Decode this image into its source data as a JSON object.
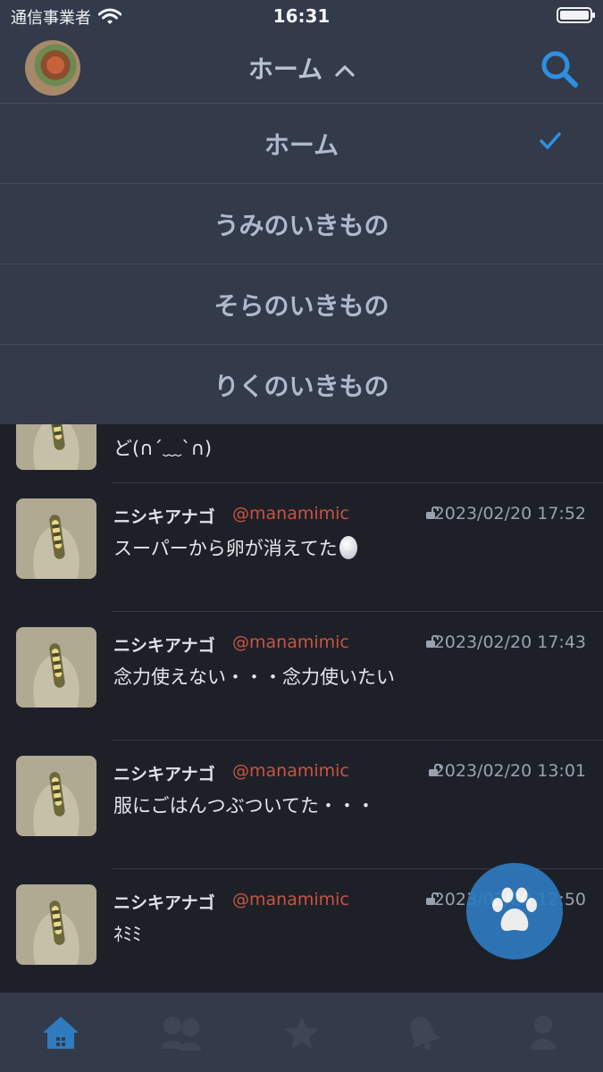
{
  "status_bar": {
    "carrier": "通信事業者",
    "time": "16:31"
  },
  "nav": {
    "title": "ホーム",
    "title_chevron": "chevron-up-icon",
    "search_icon": "search-icon"
  },
  "menu": {
    "items": [
      {
        "label": "ホーム",
        "selected": true
      },
      {
        "label": "うみのいきもの",
        "selected": false
      },
      {
        "label": "そらのいきもの",
        "selected": false
      },
      {
        "label": "りくのいきもの",
        "selected": false
      }
    ]
  },
  "timeline": {
    "partial_text": "ど(∩´﹏`∩)",
    "tweets": [
      {
        "name": "ニシキアナゴ",
        "handle": "@manamimic",
        "date": "2023/02/20 17:52",
        "text": "スーパーから卵が消えてた"
      },
      {
        "name": "ニシキアナゴ",
        "handle": "@manamimic",
        "date": "2023/02/20 17:43",
        "text": "念力使えない・・・念力使いたい"
      },
      {
        "name": "ニシキアナゴ",
        "handle": "@manamimic",
        "date": "2023/02/20 13:01",
        "text": "服にごはんつぶついてた・・・"
      },
      {
        "name": "ニシキアナゴ",
        "handle": "@manamimic",
        "date": "2023/02/20 12:50",
        "text": "ﾈﾐﾐ"
      }
    ]
  },
  "fab": {
    "icon": "paw-icon"
  },
  "tab_bar": {
    "tabs": [
      {
        "icon": "home-icon",
        "active": true
      },
      {
        "icon": "users-icon",
        "active": false
      },
      {
        "icon": "star-icon",
        "active": false
      },
      {
        "icon": "bell-icon",
        "active": false
      },
      {
        "icon": "person-icon",
        "active": false
      }
    ]
  },
  "colors": {
    "accent": "#2f7bbf",
    "handle": "#c8553f",
    "bar_bg": "#333a4a",
    "page_bg": "#1e2028"
  }
}
